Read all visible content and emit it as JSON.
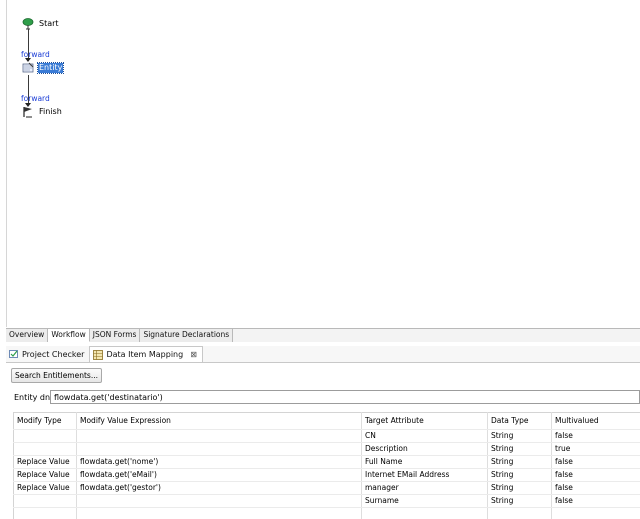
{
  "workflow": {
    "nodes": {
      "start": "Start",
      "entity": "Entity",
      "finish": "Finish"
    },
    "edges": [
      "forward",
      "forward"
    ]
  },
  "editor_tabs": [
    "Overview",
    "Workflow",
    "JSON Forms",
    "Signature Declarations"
  ],
  "view_tabs": {
    "project_checker": "Project Checker",
    "data_item_mapping": "Data Item Mapping"
  },
  "search_button": "Search Entitlements...",
  "entity_dn": {
    "label": "Entity dn:",
    "value": "flowdata.get('destinatario')"
  },
  "table": {
    "columns": [
      "Modify Type",
      "Modify Value Expression",
      "Target Attribute",
      "Data Type",
      "Multivalued"
    ],
    "rows": [
      [
        "",
        "",
        "CN",
        "String",
        "false"
      ],
      [
        "",
        "",
        "Description",
        "String",
        "true"
      ],
      [
        "Replace Value",
        "flowdata.get('nome')",
        "Full Name",
        "String",
        "false"
      ],
      [
        "Replace Value",
        "flowdata.get('eMail')",
        "Internet EMail Address",
        "String",
        "false"
      ],
      [
        "Replace Value",
        "flowdata.get('gestor')",
        "manager",
        "String",
        "false"
      ],
      [
        "",
        "",
        "Surname",
        "String",
        "false"
      ],
      [
        "",
        "",
        "",
        "",
        ""
      ],
      [
        "",
        "",
        "",
        "",
        ""
      ]
    ]
  },
  "colors": {
    "selection": "#3a7bd5",
    "edge_label": "#1a3cd6"
  }
}
